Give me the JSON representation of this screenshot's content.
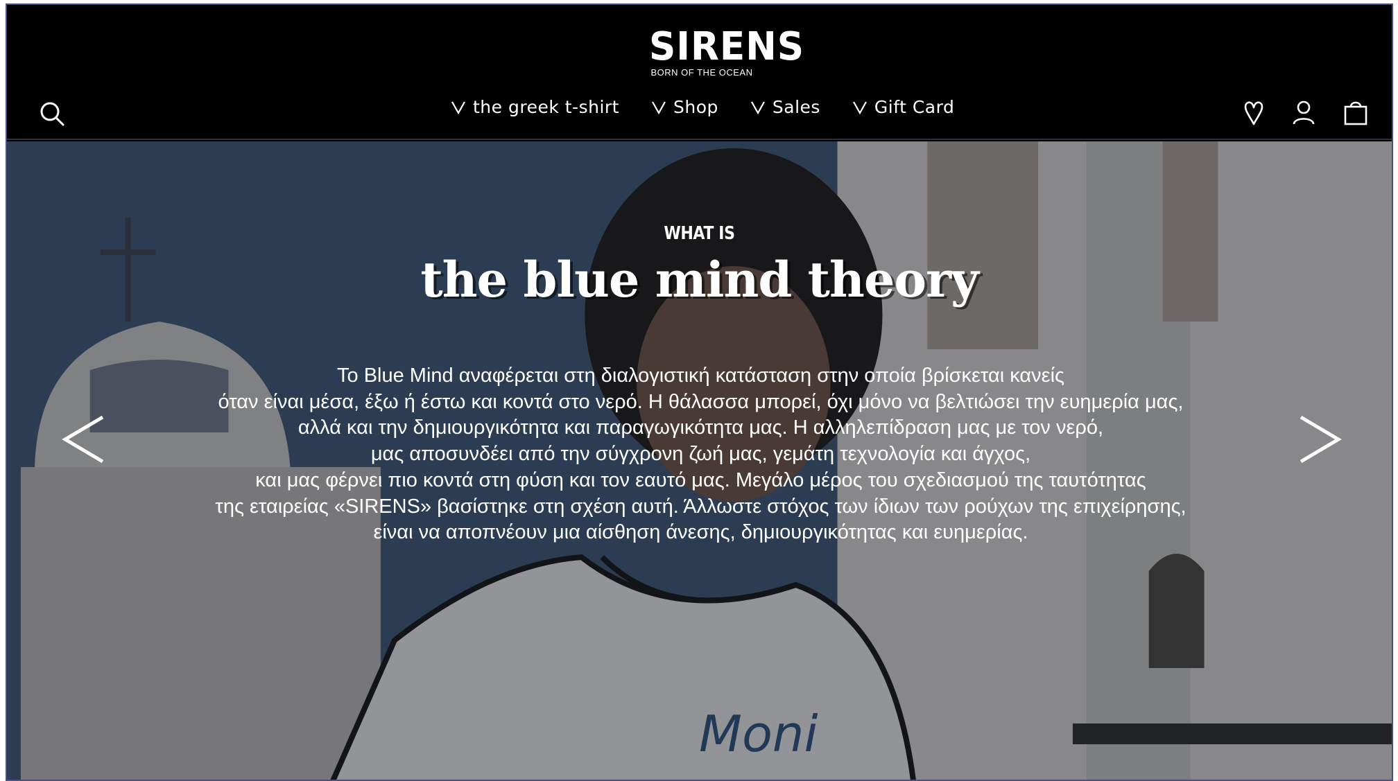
{
  "brand": {
    "logo_text": "SIRENS",
    "tagline": "BORN OF THE OCEAN"
  },
  "nav": {
    "items": [
      {
        "label": "the greek t-shirt"
      },
      {
        "label": "Shop"
      },
      {
        "label": "Sales"
      },
      {
        "label": "Gift Card"
      }
    ]
  },
  "header_icons": [
    "search-icon",
    "heart-icon",
    "user-icon",
    "bag-icon"
  ],
  "hero": {
    "kicker": "WHAT IS",
    "title": "the blue mind theory",
    "shirt_text": "Moni",
    "body_lines": [
      "Το Blue Mind αναφέρεται στη διαλογιστική κατάσταση στην οποία βρίσκεται κανείς",
      "όταν είναι μέσα, έξω ή έστω και κοντά στο νερό. Η θάλασσα μπορεί, όχι μόνο να βελτιώσει την ευημερία μας,",
      "αλλά και την δημιουργικότητα και παραγωγικότητα μας. Η αλληλεπίδραση μας με τον νερό,",
      "μας αποσυνδέει από την σύγχρονη ζωή μας, γεμάτη τεχνολογία και άγχος,",
      "και μας φέρνει πιο κοντά στη φύση και τον εαυτό μας. Μεγάλο μέρος του σχεδιασμού της ταυτότητας",
      "της εταιρείας «SIRENS» βασίστηκε στη σχέση αυτή. Άλλωστε στόχος των ίδιων των ρούχων της επιχείρησης,",
      "είναι να αποπνέουν μια αίσθηση άνεσης, δημιουργικότητας και ευημερίας."
    ]
  },
  "colors": {
    "header_bg": "#000000",
    "text": "#ffffff",
    "frame_border": "#4a4f8a",
    "shirt_text": "#2a4f7a"
  }
}
